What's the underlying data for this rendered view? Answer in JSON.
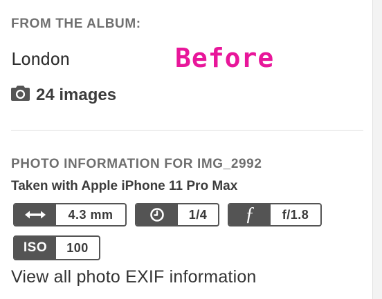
{
  "album": {
    "heading": "FROM THE ALBUM:",
    "name": "London",
    "count_label": "24 images",
    "count_icon": "camera-icon"
  },
  "annotation": {
    "text": "Before",
    "color": "#e8169a"
  },
  "photo": {
    "heading": "PHOTO INFORMATION FOR IMG_2992",
    "device": "Taken with Apple iPhone 11 Pro Max",
    "exif": {
      "focal_length": {
        "icon": "horizontal-arrows-icon",
        "value": "4.3 mm"
      },
      "shutter_speed": {
        "icon": "clock-icon",
        "value": "1/4"
      },
      "aperture": {
        "icon": "f-stop-icon",
        "glyph": "ƒ",
        "value": "f/1.8"
      },
      "iso": {
        "label": "ISO",
        "value": "100"
      }
    },
    "view_all_link": "View all photo EXIF information"
  },
  "colors": {
    "chip_dark": "#545454",
    "heading_gray": "#6f6f6f",
    "text_dark": "#3c3c3c"
  }
}
